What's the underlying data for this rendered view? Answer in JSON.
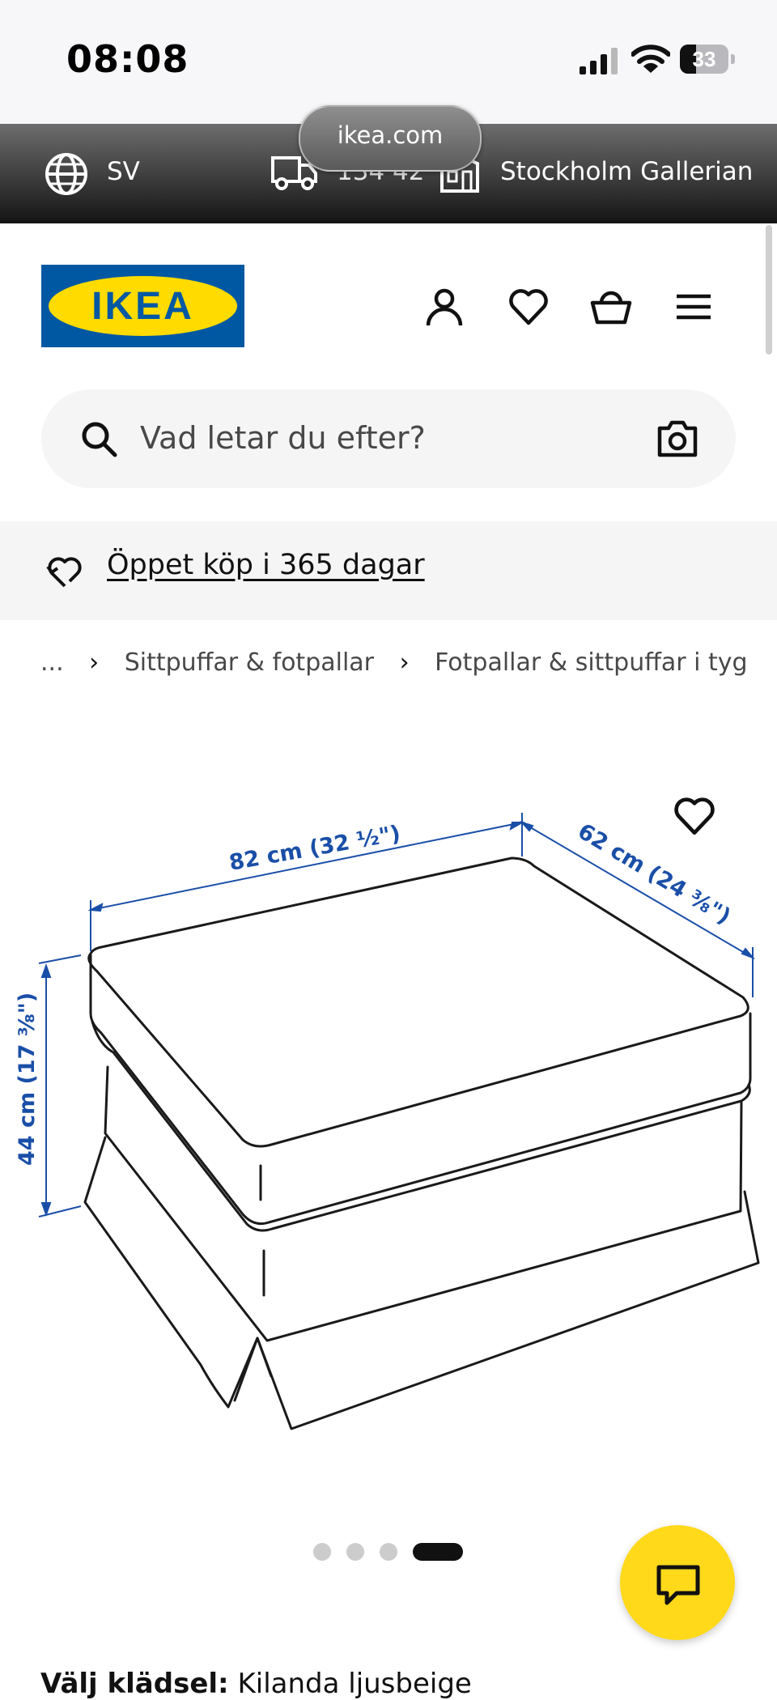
{
  "status_bar": {
    "time": "08:08",
    "battery": "33"
  },
  "browser": {
    "url": "ikea.com"
  },
  "locale_bar": {
    "language": "SV",
    "postal_code": "134 42",
    "store": "Stockholm Gallerian"
  },
  "header": {
    "logo_text": "IKEA"
  },
  "search": {
    "placeholder": "Vad letar du efter?"
  },
  "promo": {
    "text": "Öppet köp i 365 dagar"
  },
  "breadcrumb": {
    "ellipsis": "...",
    "items": [
      "Sittpuffar & fotpallar",
      "Fotpallar & sittpuffar i tyg"
    ]
  },
  "product_image": {
    "width_label": "82 cm (32 ½\")",
    "depth_label": "62 cm (24 ⅜\")",
    "height_label": "44 cm (17 ⅜\")"
  },
  "carousel": {
    "count": 4,
    "active_index": 3
  },
  "bottom_peek": {
    "bold": "Välj klädsel:",
    "rest": " Kilanda ljusbeige"
  },
  "colors": {
    "ikea_blue": "#0058a3",
    "ikea_yellow": "#ffdb00",
    "chat_yellow": "#ffd91a",
    "dimension_blue": "#1a4fa8"
  }
}
